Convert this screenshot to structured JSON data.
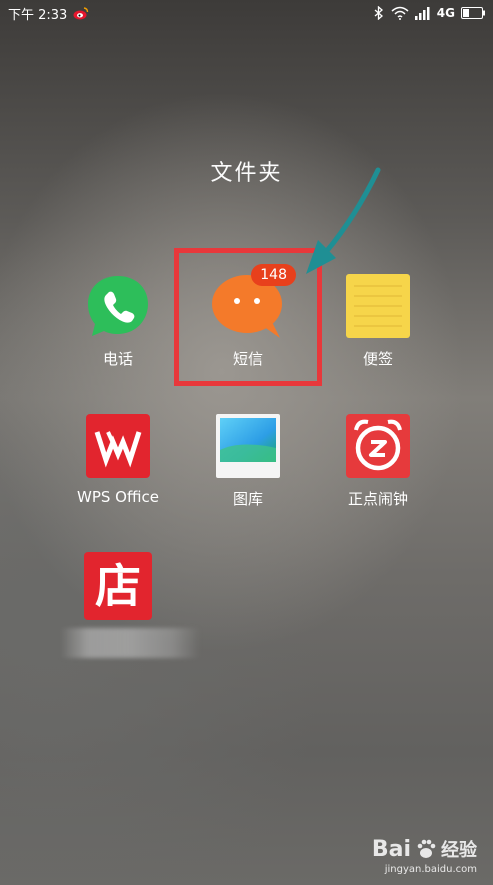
{
  "status_bar": {
    "time": "下午 2:33",
    "network": "4G"
  },
  "folder": {
    "title": "文件夹"
  },
  "apps": [
    {
      "label": "电话",
      "icon": "phone-icon",
      "color": "#2dbe5a"
    },
    {
      "label": "短信",
      "icon": "message-icon",
      "color": "#f47a2a",
      "badge": "148"
    },
    {
      "label": "便签",
      "icon": "notepad-icon",
      "color": "#f6d54a"
    },
    {
      "label": "WPS Office",
      "icon": "wps-icon",
      "color": "#e2252e"
    },
    {
      "label": "图库",
      "icon": "gallery-icon",
      "color": "#2d9ee6"
    },
    {
      "label": "正点闹钟",
      "icon": "alarm-icon",
      "color": "#e63a3c"
    },
    {
      "label": "",
      "icon": "store-icon",
      "color": "#e2252e"
    }
  ],
  "store_icon_text": "店",
  "watermark": {
    "brand_left": "Bai",
    "brand_right": "经验",
    "url": "jingyan.baidu.com"
  },
  "colors": {
    "highlight": "#e8383b",
    "arrow": "#1f8f94"
  }
}
